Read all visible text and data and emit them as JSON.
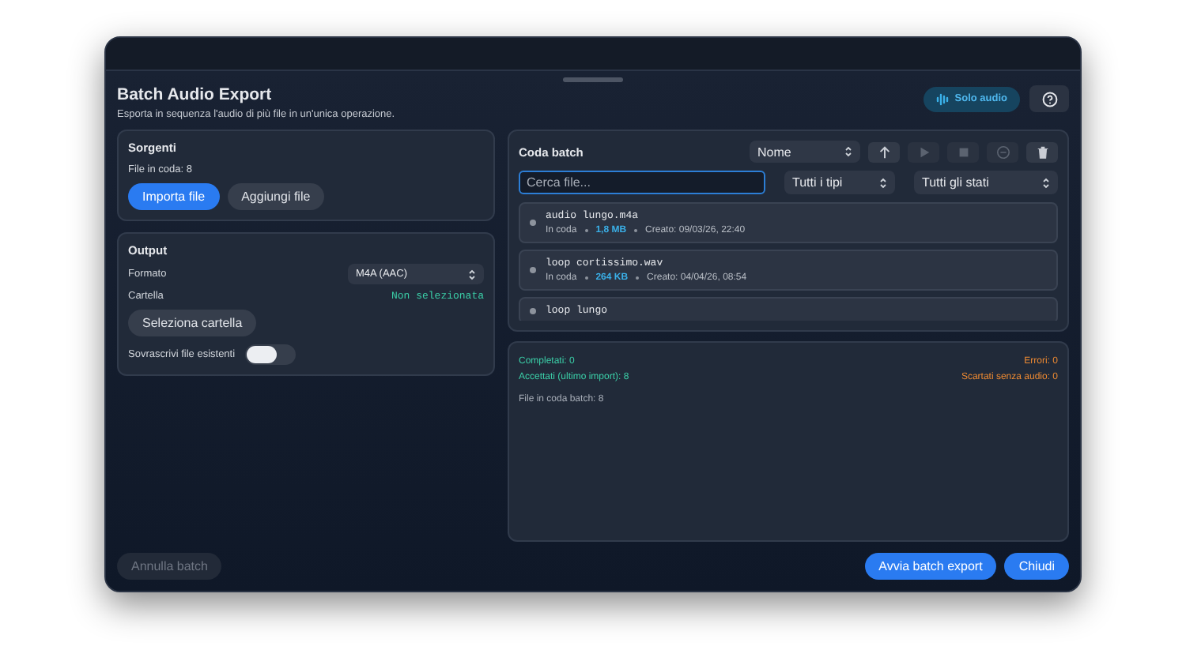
{
  "window": {
    "title": "Batch Audio Export",
    "subtitle": "Esporta in sequenza l'audio di più file in un'unica operazione."
  },
  "badge": {
    "label": "Solo audio"
  },
  "sources": {
    "title": "Sorgenti",
    "count": "File in coda: 8",
    "buttons": [
      {
        "label": "Importa file",
        "kind": "primary"
      },
      {
        "label": "Aggiungi file",
        "kind": "secondary"
      }
    ]
  },
  "output": {
    "title": "Output",
    "format": {
      "label": "Formato",
      "value": "M4A (AAC)"
    },
    "folder": {
      "label": "Cartella",
      "value": "Non selezionata"
    },
    "choose_button": "Seleziona cartella",
    "overwrite": {
      "label": "Sovrascrivi file esistenti",
      "on": false
    }
  },
  "queue": {
    "title": "Coda batch",
    "sort": "Nome",
    "toolbar": [
      {
        "kind": "up",
        "disabled": false
      },
      {
        "kind": "play",
        "disabled": true
      },
      {
        "kind": "stop",
        "disabled": true
      },
      {
        "kind": "remove",
        "disabled": true
      },
      {
        "kind": "trash",
        "disabled": false
      }
    ],
    "search": {
      "placeholder": "Cerca file..."
    },
    "type_filter": "Tutti i tipi",
    "status_filter": "Tutti gli stati",
    "items": [
      {
        "name": "audio lungo.m4a",
        "status": "In coda",
        "size": "1,8 MB",
        "created": "Creato: 09/03/26, 22:40"
      },
      {
        "name": "loop cortissimo.wav",
        "status": "In coda",
        "size": "264 KB",
        "created": "Creato: 04/04/26, 08:54"
      },
      {
        "name": "loop lungo"
      }
    ]
  },
  "summary": {
    "completed": "Completati: 0",
    "errors": "Errori: 0",
    "accepted": "Accettati (ultimo import): 8",
    "discarded": "Scartati senza audio: 0",
    "queued": "File in coda batch: 8"
  },
  "footer": {
    "cancel": {
      "label": "Annulla batch",
      "disabled": true
    },
    "buttons": [
      {
        "label": "Avvia batch export"
      },
      {
        "label": "Chiudi"
      }
    ]
  }
}
